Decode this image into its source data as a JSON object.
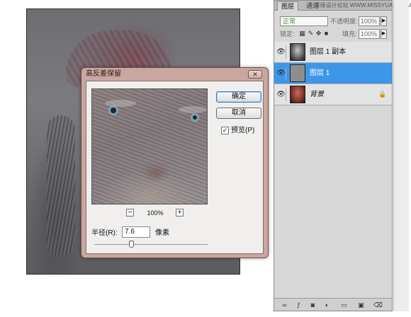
{
  "dialog": {
    "title": "高反差保留",
    "close_label": "✕",
    "ok_label": "确定",
    "cancel_label": "取消",
    "preview_label": "预览(P)",
    "preview_checked": true,
    "preview_check_mark": "✓",
    "zoom_minus": "−",
    "zoom_plus": "+",
    "zoom_value": "100%",
    "radius_label": "半径(R):",
    "radius_value": "7.6",
    "radius_unit": "像素",
    "radius_slider_fraction": 0.33
  },
  "panel": {
    "tabs": [
      "图层",
      "通道"
    ],
    "watermark": "思缘设计论坛 WWW.MISSYUAN.COM",
    "blend_mode": "正常",
    "opacity_label": "不透明度:",
    "opacity_value": "100%",
    "lock_label": "锁定:",
    "fill_label": "填充:",
    "fill_value": "100%",
    "layers": [
      {
        "name": "图层 1 副本",
        "selected": false
      },
      {
        "name": "图层 1",
        "selected": true
      },
      {
        "name": "背景",
        "selected": false,
        "locked": true
      }
    ],
    "icons": {
      "eye": "👁",
      "lock": "🔒",
      "dropdown": "▶"
    }
  },
  "colors": {
    "selected_layer": "#3d97e9",
    "dialog_frame": "#c9a7a0"
  }
}
